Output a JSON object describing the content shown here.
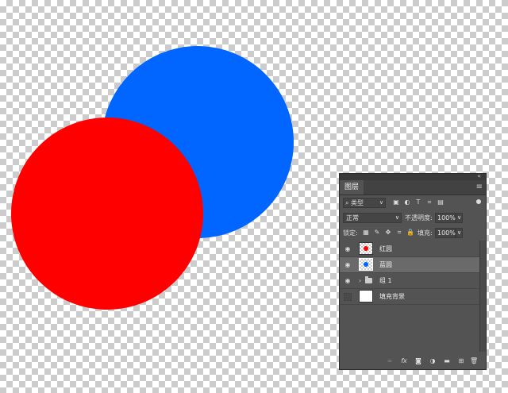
{
  "canvas": {
    "blue_color": "#0066ff",
    "red_color": "#ff0000"
  },
  "panel": {
    "collapse_icon": "double-arrow-icon",
    "tab_label": "图层",
    "menu_icon": "menu-icon",
    "filter_label": "类型",
    "blend_mode": "正常",
    "opacity_label": "不透明度:",
    "opacity_value": "100%",
    "lock_label": "锁定:",
    "fill_label": "填充:",
    "fill_value": "100%",
    "layers": [
      {
        "name": "红圆",
        "visible": true,
        "selected": false,
        "dot_color": "#ff0000"
      },
      {
        "name": "蓝圆",
        "visible": true,
        "selected": true,
        "dot_color": "#0066ff"
      },
      {
        "name": "组 1",
        "visible": true,
        "selected": false,
        "type": "group"
      },
      {
        "name": "填充背景",
        "visible": false,
        "selected": false,
        "type": "fill"
      }
    ]
  }
}
